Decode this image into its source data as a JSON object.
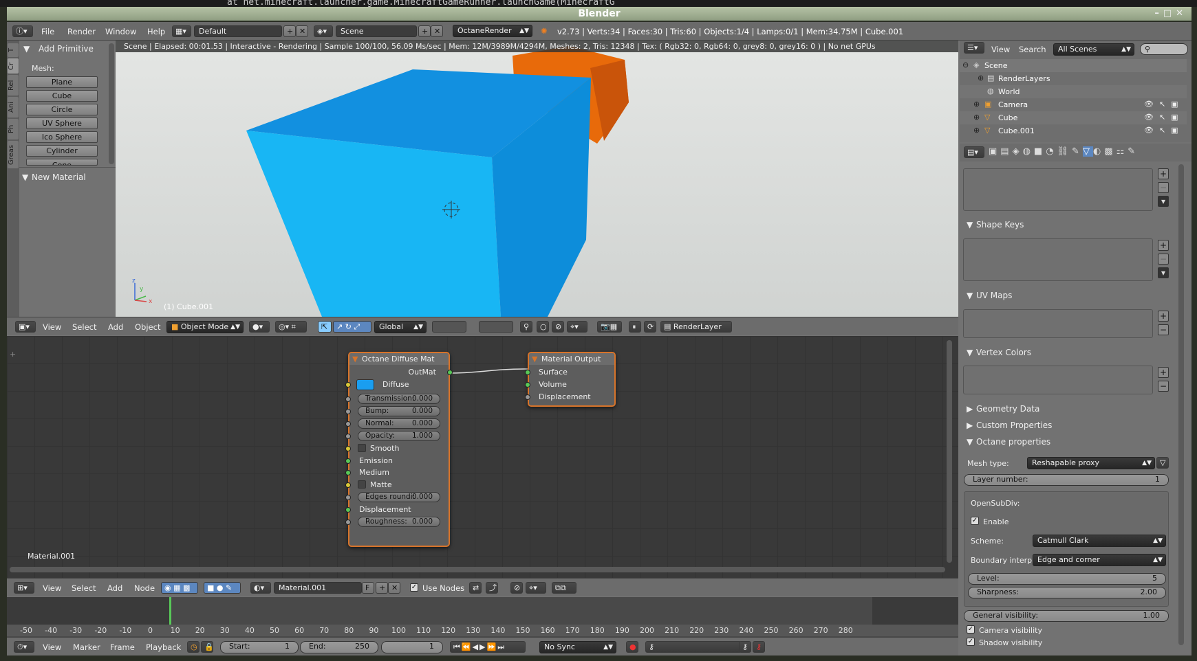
{
  "terminal_line": "at net.minecraft.launcher.game.MinecraftGameRunner.launchGame(MinecraftG",
  "window": {
    "title": "Blender",
    "controls": "–□✕"
  },
  "info_header": {
    "menus": [
      "File",
      "Render",
      "Window",
      "Help"
    ],
    "layout": "Default",
    "scene": "Scene",
    "engine": "OctaneRender",
    "stats": "v2.73 | Verts:34 | Faces:30 | Tris:60 | Objects:1/4 | Lamps:0/1 | Mem:34.75M | Cube.001"
  },
  "viewport": {
    "status": "Scene | Elapsed: 00:01.53 | Interactive - Rendering | Sample 100/100, 56.09 Ms/sec | Mem: 12M/3989M/4294M, Meshes: 2, Tris: 12348 | Tex: ( Rgb32: 0, Rgb64: 0, grey8: 0, grey16: 0 ) | No net GPUs",
    "object_label": "(1) Cube.001",
    "axis_x": "x",
    "axis_y": "y",
    "axis_z": "z",
    "colors": {
      "cube_top": "#1287dc",
      "cube_front": "#12b2f2",
      "cube_side": "#0e8ad8",
      "orange": "#f07a14"
    }
  },
  "toolshelf": {
    "tabs": [
      "T",
      "Cr",
      "Rel",
      "Ani",
      "Ph",
      "Greas"
    ],
    "panel_title": "Add Primitive",
    "mesh_label": "Mesh:",
    "items": [
      "Plane",
      "Cube",
      "Circle",
      "UV Sphere",
      "Ico Sphere",
      "Cylinder",
      "Cone"
    ],
    "new_material": "New Material"
  },
  "view3d_header": {
    "menus": [
      "View",
      "Select",
      "Add",
      "Object"
    ],
    "mode": "Object Mode",
    "orientation": "Global",
    "render_layer": "RenderLayer"
  },
  "node_editor": {
    "material_label": "Material.001",
    "diffuse_node": {
      "title": "Octane Diffuse Mat",
      "out": "OutMat",
      "diffuse": "Diffuse",
      "diffuse_color": "#1a9ef0",
      "transmission": {
        "label": "Transmission:",
        "value": "0.000"
      },
      "bump": {
        "label": "Bump:",
        "value": "0.000"
      },
      "normal": {
        "label": "Normal:",
        "value": "0.000"
      },
      "opacity": {
        "label": "Opacity:",
        "value": "1.000"
      },
      "smooth": "Smooth",
      "emission": "Emission",
      "medium": "Medium",
      "matte": "Matte",
      "edges": {
        "label": "Edges roundi:",
        "value": "0.000"
      },
      "displacement": "Displacement",
      "roughness": {
        "label": "Roughness:",
        "value": "0.000"
      }
    },
    "output_node": {
      "title": "Material Output",
      "surface": "Surface",
      "volume": "Volume",
      "displacement": "Displacement"
    }
  },
  "node_header": {
    "menus": [
      "View",
      "Select",
      "Add",
      "Node"
    ],
    "material": "Material.001",
    "fake": "F",
    "use_nodes": "Use Nodes"
  },
  "timeline": {
    "ticks": [
      "-50",
      "-40",
      "-30",
      "-20",
      "-10",
      "0",
      "10",
      "20",
      "30",
      "40",
      "50",
      "60",
      "70",
      "80",
      "90",
      "100",
      "110",
      "120",
      "130",
      "140",
      "150",
      "160",
      "170",
      "180",
      "190",
      "200",
      "210",
      "220",
      "230",
      "240",
      "250",
      "260",
      "270",
      "280"
    ],
    "menus": [
      "View",
      "Marker",
      "Frame",
      "Playback"
    ],
    "start": {
      "label": "Start:",
      "value": "1"
    },
    "end": {
      "label": "End:",
      "value": "250"
    },
    "current": "1",
    "sync": "No Sync"
  },
  "outliner": {
    "menus": [
      "View",
      "Search"
    ],
    "filter": "All Scenes",
    "items": [
      "Scene",
      "RenderLayers",
      "World",
      "Camera",
      "Cube",
      "Cube.001"
    ]
  },
  "properties": {
    "shape_keys": "Shape Keys",
    "uv_maps": "UV Maps",
    "vertex_colors": "Vertex Colors",
    "geometry_data": "Geometry Data",
    "custom_properties": "Custom Properties",
    "octane_properties": "Octane properties",
    "mesh_type": {
      "label": "Mesh type:",
      "value": "Reshapable proxy"
    },
    "layer_number": {
      "label": "Layer number:",
      "value": "1"
    },
    "opensubdiv": "OpenSubDiv:",
    "enable": "Enable",
    "scheme": {
      "label": "Scheme:",
      "value": "Catmull Clark"
    },
    "boundary": {
      "label": "Boundary interp.:",
      "value": "Edge and corner"
    },
    "level": {
      "label": "Level:",
      "value": "5"
    },
    "sharpness": {
      "label": "Sharpness:",
      "value": "2.00"
    },
    "general_visibility": {
      "label": "General visibility:",
      "value": "1.00"
    },
    "camera_visibility": "Camera visibility",
    "shadow_visibility": "Shadow visibility"
  }
}
